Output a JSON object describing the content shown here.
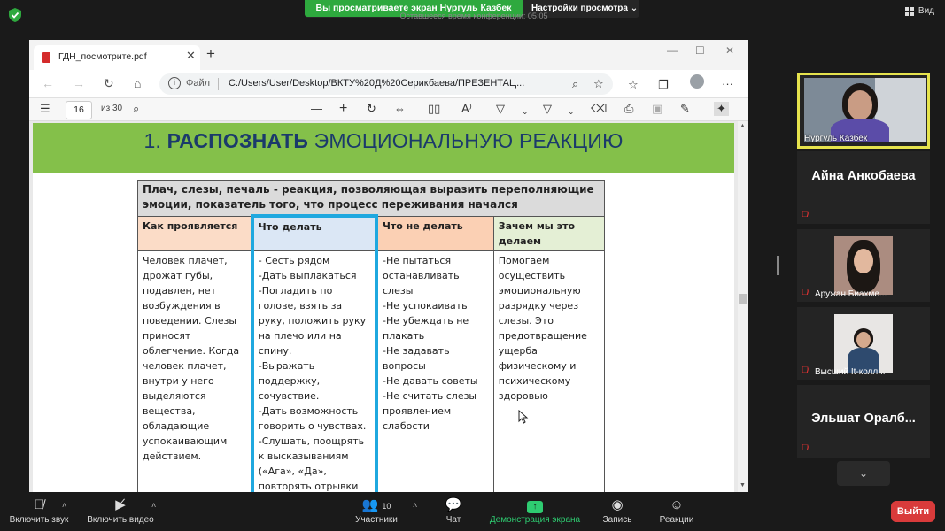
{
  "zoom": {
    "share_banner": "Вы просматриваете экран Нургуль Казбек",
    "view_options": "Настройки просмотра ⌄",
    "timer_text": "Оставшееся время конференции: 05:05",
    "view_button": "Вид",
    "participants_count": "10",
    "controls": {
      "unmute": "Включить звук",
      "start_video": "Включить видео",
      "participants": "Участники",
      "chat": "Чат",
      "share": "Демонстрация экрана",
      "record": "Запись",
      "reactions": "Реакции"
    },
    "leave": "Выйти",
    "colors": {
      "share_green": "#2ea93e",
      "leave_red": "#d93b3b",
      "active_tile": "#e6e34d"
    }
  },
  "participants": [
    {
      "name": "Нургуль Казбек",
      "type": "video"
    },
    {
      "name": "Айна Анкобаева",
      "type": "name"
    },
    {
      "name": "Аружан Биахме...",
      "type": "photo"
    },
    {
      "name": "Высший It-колл...",
      "type": "photo"
    },
    {
      "name": "Эльшат  Оралб...",
      "type": "name"
    }
  ],
  "browser": {
    "tab_title": "ГДН_посмотрите.pdf",
    "address_label": "Файл",
    "url": "C:/Users/User/Desktop/ВКТУ%20Д%20Серикбаева/ПРЕЗЕНТАЦ...",
    "pdf_page": "16",
    "pdf_page_total": "из 30"
  },
  "slide": {
    "title_prefix": "1. ",
    "title_bold": "РАСПОЗНАТЬ",
    "title_rest": " ЭМОЦИОНАЛЬНУЮ РЕАКЦИЮ",
    "header_row": "Плач, слезы, печаль - реакция, позволяющая выразить переполняющие эмоции, показатель того, что процесс переживания начался",
    "columns": [
      "Как проявляется",
      "Что делать",
      "Что не делать",
      "Зачем мы это делаем"
    ],
    "cells": [
      "Человек плачет, дрожат губы, подавлен, нет возбуждения в поведении. Слезы приносят облегчение. Когда человек плачет, внутри у него выделяются вещества, обладающие успокаивающим действием.",
      "- Сесть рядом\n-Дать выплакаться\n-Погладить по голове, взять за руку, положить руку на плечо или на спину.\n -Выражать поддержку, сочувствие.\n-Дать возможность говорить о чувствах.\n -Слушать, поощрять к высказываниям («Ага», «Да», повторять отрывки фраз, кивать)",
      "-Не пытаться останавливать слезы\n -Не успокаивать\n -Не убеждать не плакать\n -Не задавать вопросы\n -Не давать советы\n-Не считать слезы проявлением слабости",
      "Помогаем осуществить эмоциональную разрядку через слезы. Это предотвращение ущерба физическому и психическому здоровью"
    ]
  }
}
